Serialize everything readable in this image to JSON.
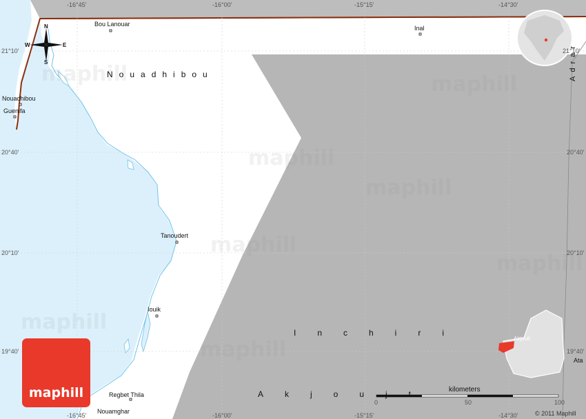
{
  "map": {
    "regions": [
      {
        "name": "Nouadhibou"
      },
      {
        "name": "Inchiri"
      },
      {
        "name": "Akjoujt"
      }
    ],
    "places": [
      {
        "name": "Bou Lanouar"
      },
      {
        "name": "Inal"
      },
      {
        "name": "Nouadhibou"
      },
      {
        "name": "Guenifa"
      },
      {
        "name": "Tanoudert"
      },
      {
        "name": "Iouik"
      },
      {
        "name": "Regbet Thila"
      },
      {
        "name": "Nouamghar"
      },
      {
        "name": "Akjouit"
      },
      {
        "name": "Ata"
      },
      {
        "name": "Adrar"
      }
    ],
    "top_longitudes": [
      "-16°45'",
      "-16°00'",
      "-15°15'",
      "-14°30'"
    ],
    "bottom_longitudes": [
      "-16°45'",
      "-16°00'",
      "-15°15'",
      "-14°30'"
    ],
    "left_latitudes": [
      "21°10'",
      "20°40'",
      "20°10'",
      "19°40'"
    ],
    "right_latitudes": [
      "21°10'",
      "20°40'",
      "20°10'",
      "19°40'"
    ],
    "compass": {
      "n": "N",
      "s": "S",
      "e": "E",
      "w": "W"
    },
    "scale": {
      "label": "kilometers",
      "ticks": [
        "0",
        "50",
        "100"
      ]
    },
    "copyright": "© 2011 Maphill",
    "logo_text": "maphill",
    "watermark": "maphill",
    "colors": {
      "sea": "#dcf0fb",
      "land_selected": "#ffffff",
      "land_other": "#b6b6b6",
      "border": "#8b2e0e",
      "accent": "#e8392b"
    }
  }
}
